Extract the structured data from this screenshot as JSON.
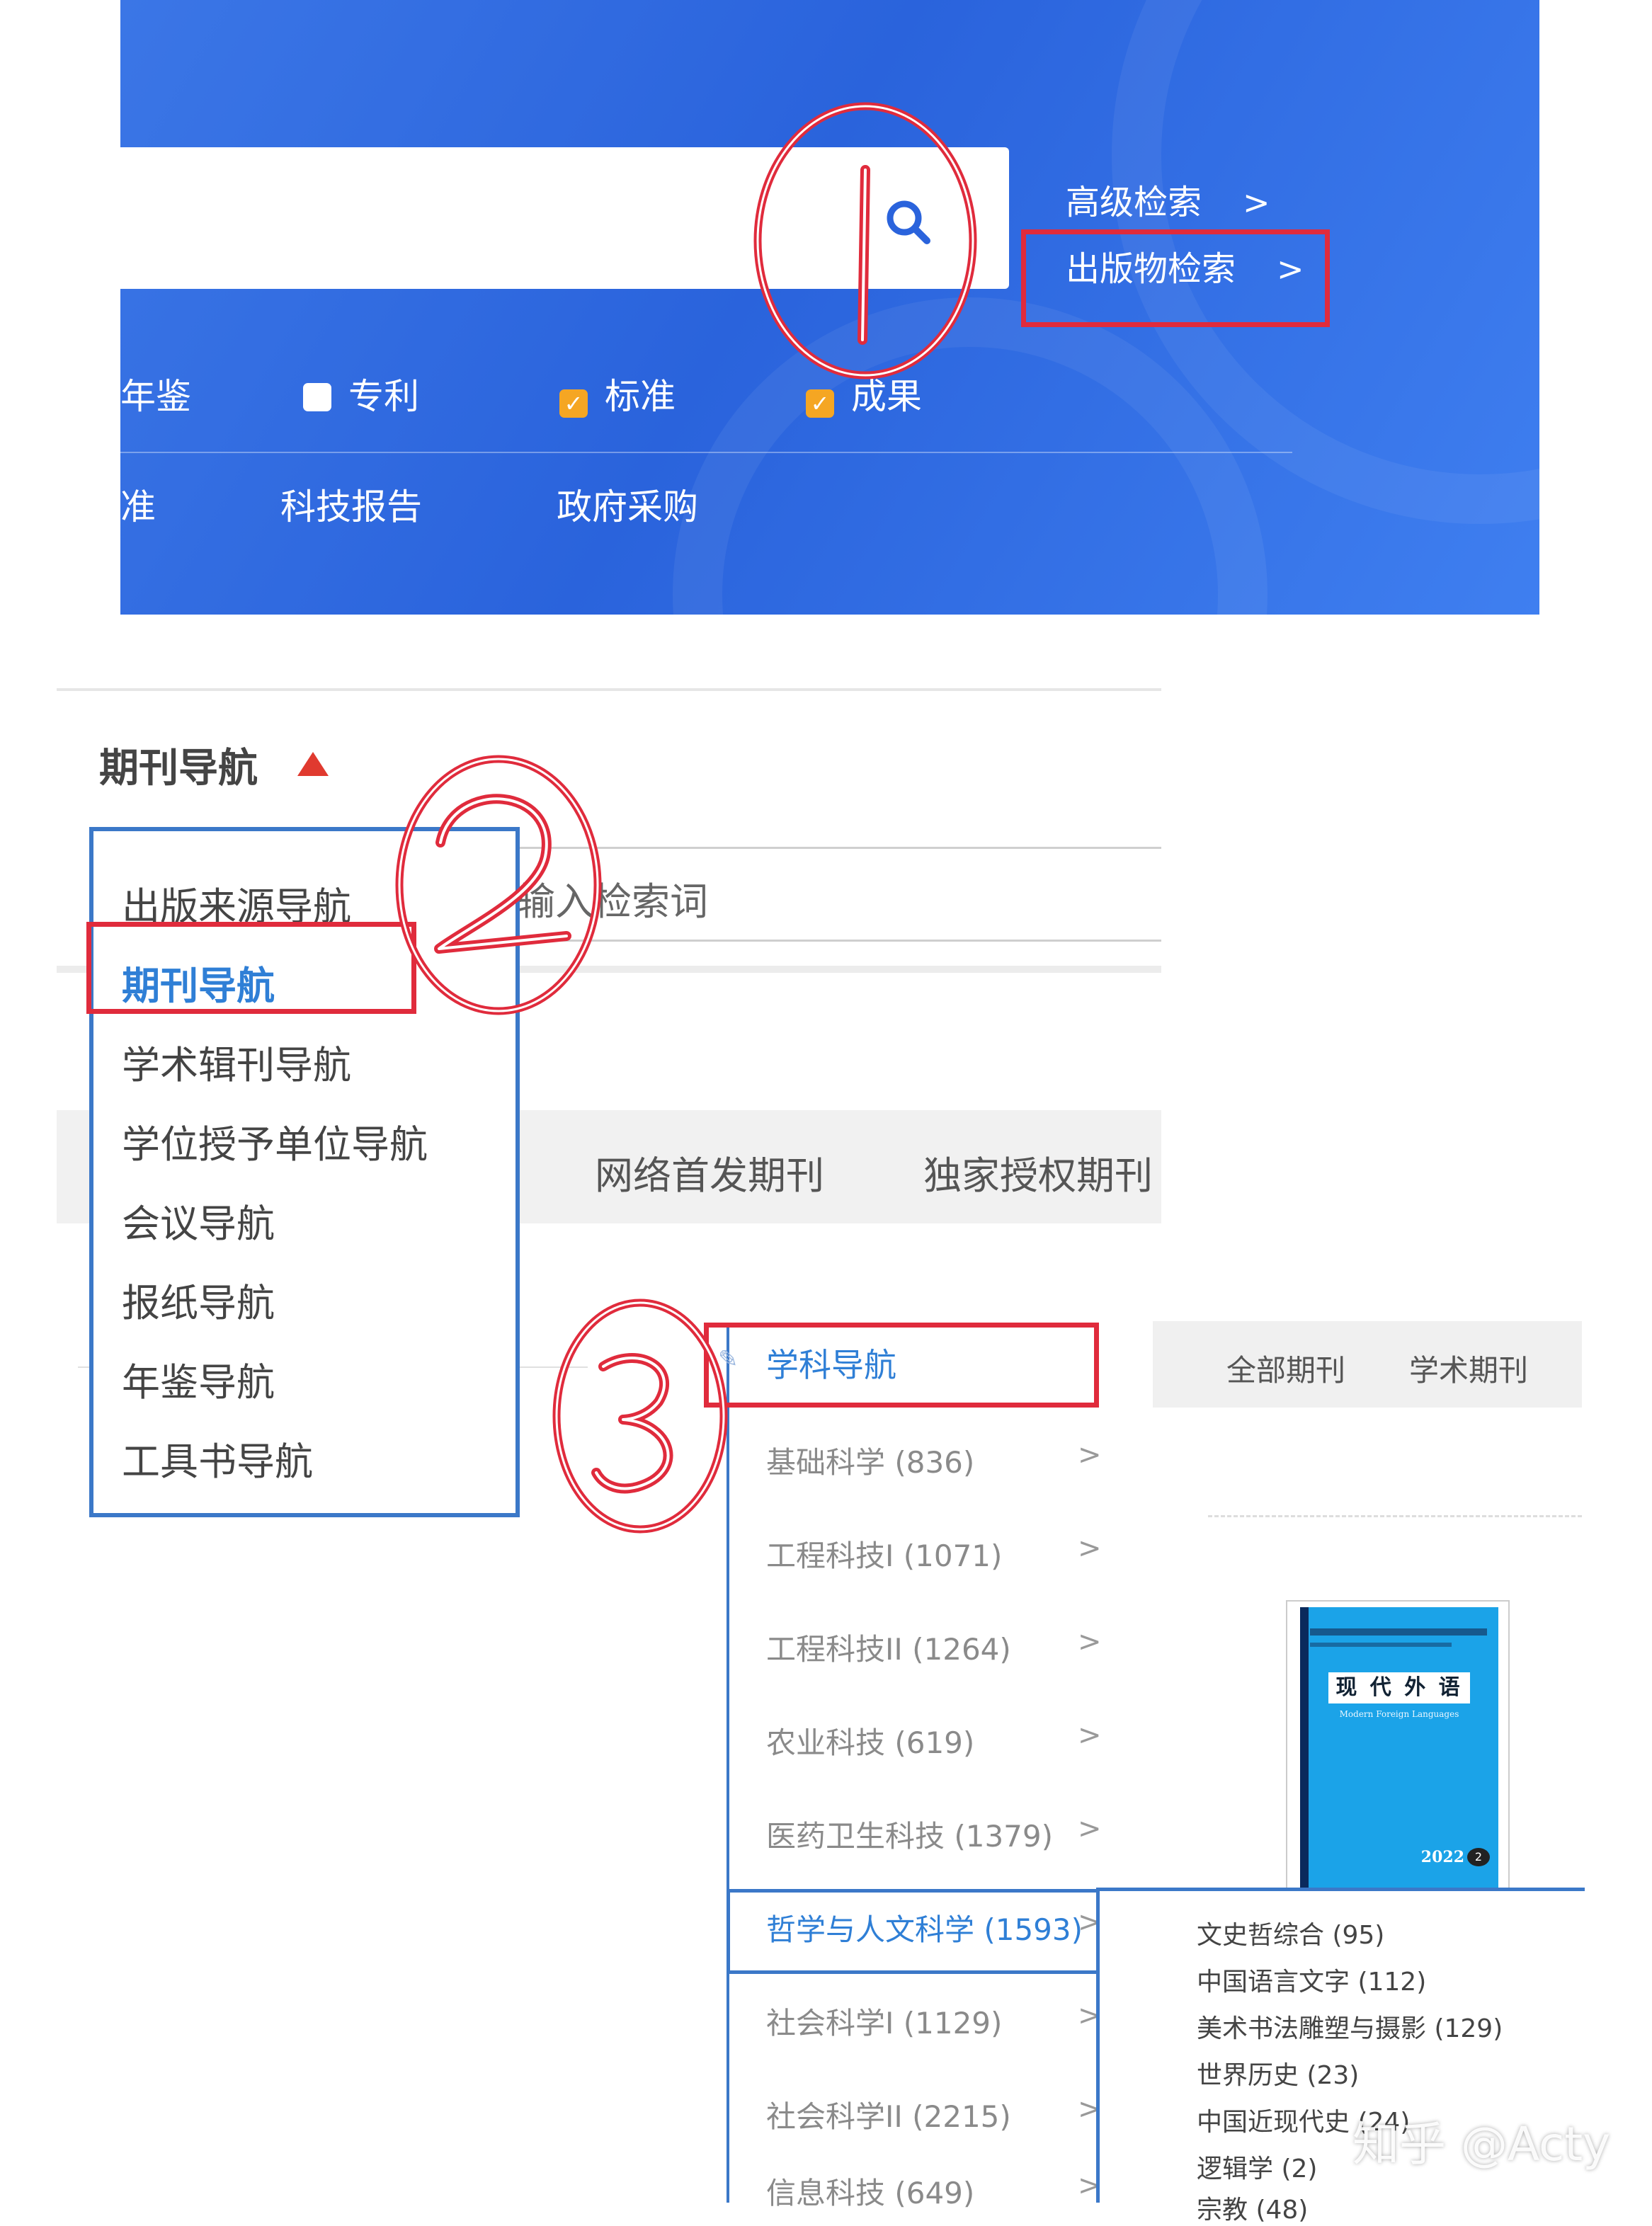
{
  "banner": {
    "advanced_search": "高级检索",
    "publication_search": "出版物检索",
    "chevron": ">",
    "checkbox_row": [
      {
        "label": "年鉴",
        "state": "none"
      },
      {
        "label": "专利",
        "state": "unchecked"
      },
      {
        "label": "标准",
        "state": "checked"
      },
      {
        "label": "成果",
        "state": "checked"
      }
    ],
    "category_row": [
      "准",
      "科技报告",
      "政府采购"
    ]
  },
  "navigation": {
    "title": "期刊导航",
    "search_placeholder": "输入检索词",
    "dropdown_items": [
      "出版来源导航",
      "期刊导航",
      "学术辑刊导航",
      "学位授予单位导航",
      "会议导航",
      "报纸导航",
      "年鉴导航",
      "工具书导航"
    ],
    "selected_item": "期刊导航",
    "tabs": [
      "网络首发期刊",
      "独家授权期刊"
    ]
  },
  "subject_nav": {
    "title": "学科导航",
    "items": [
      {
        "label": "基础科学 (836)"
      },
      {
        "label": "工程科技I (1071)"
      },
      {
        "label": "工程科技II (1264)"
      },
      {
        "label": "农业科技 (619)"
      },
      {
        "label": "医药卫生科技 (1379)"
      },
      {
        "label": "哲学与人文科学 (1593)"
      },
      {
        "label": "社会科学I (1129)"
      },
      {
        "label": "社会科学II (2215)"
      },
      {
        "label": "信息科技 (649)"
      }
    ],
    "selected": "哲学与人文科学 (1593)",
    "chevron": ">",
    "sub_items": [
      "文史哲综合 (95)",
      "中国语言文字 (112)",
      "美术书法雕塑与摄影 (129)",
      "世界历史 (23)",
      "中国近现代史 (24)",
      "逻辑学 (2)",
      "宗教 (48)"
    ],
    "filters": [
      "全部期刊",
      "学术期刊"
    ],
    "journal_cover": {
      "title": "现 代 外 语",
      "subtitle": "Modern Foreign Languages",
      "year": "2022",
      "issue": "2"
    }
  },
  "annotations": [
    "1",
    "2",
    "3"
  ],
  "watermark": "知乎 @Acty",
  "colors": {
    "banner_blue": "#2a63dc",
    "highlight_red": "#e02b3c",
    "nav_blue": "#3b78c8",
    "link_blue": "#2f7fd6",
    "checkbox_orange": "#f5a623"
  }
}
